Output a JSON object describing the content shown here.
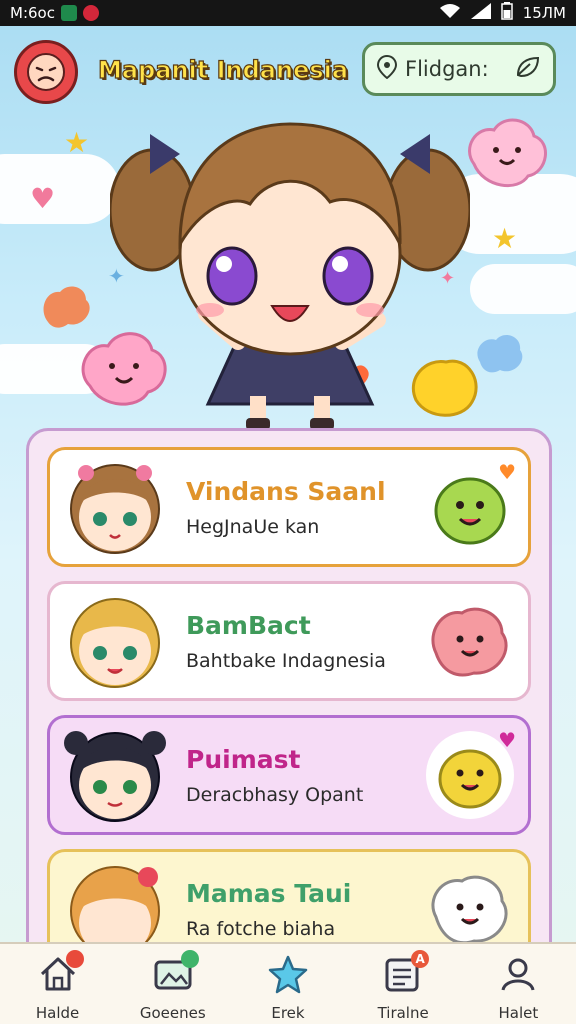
{
  "status_bar": {
    "carrier": "M:6oc",
    "time": "15ЛM"
  },
  "header": {
    "app_title": "Mapanit Indanesia",
    "filter_label": "Flidgan:"
  },
  "cards": [
    {
      "name": "Vindans Saanl",
      "subtitle": "HegJnaUe kan",
      "name_color": "#e0932a",
      "name_color2": "#5a2a8a",
      "border": "#e6a23b",
      "bg": "#ffffff"
    },
    {
      "name": "BamBact",
      "subtitle": "Bahtbake Indagnesia",
      "name_color": "#3f9a5a",
      "border": "#e6b7cf",
      "bg": "#ffffff"
    },
    {
      "name": "Puimast",
      "subtitle": "Deracbhasy Opant",
      "name_color": "#c0258a",
      "border": "#b26fd0",
      "bg": "#f6dcf6"
    },
    {
      "name": "Mamas Taui",
      "subtitle": "Ra fotche biaha",
      "name_color": "#3fa06a",
      "border": "#e6c15a",
      "bg": "#fdf6cf"
    }
  ],
  "nav": [
    {
      "label": "Halde",
      "icon": "home-icon",
      "badge": "#e84a3a"
    },
    {
      "label": "Goeenes",
      "icon": "gallery-icon",
      "badge": "#3fb46a"
    },
    {
      "label": "Erek",
      "icon": "star-icon",
      "badge": ""
    },
    {
      "label": "Tiralne",
      "icon": "list-icon",
      "badge": "#e8583a",
      "badge_text": "A"
    },
    {
      "label": "Halet",
      "icon": "profile-icon",
      "badge": ""
    }
  ]
}
